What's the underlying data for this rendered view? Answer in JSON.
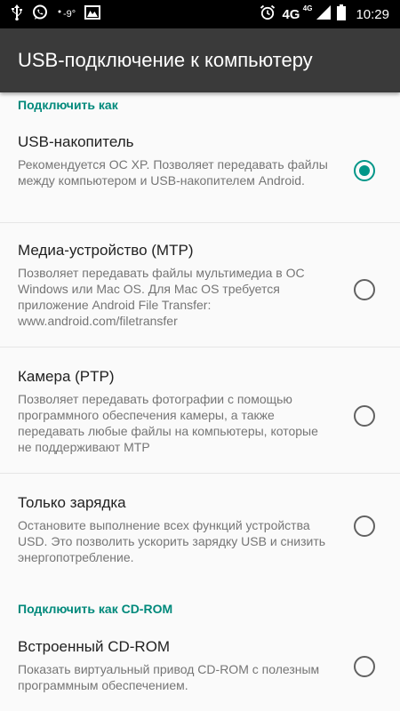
{
  "status_bar": {
    "icons_left": [
      "usb-icon",
      "whatsapp-icon",
      "weather-icon",
      "gallery-icon"
    ],
    "temperature": "-9°",
    "icons_right": [
      "alarm-icon",
      "signal-icon",
      "battery-icon"
    ],
    "network_type": "4G",
    "network_sub": "4G",
    "time": "10:29"
  },
  "app_bar": {
    "title": "USB-подключение к компьютеру"
  },
  "section_connect_as": {
    "header": "Подключить как",
    "options": [
      {
        "title": "USB-накопитель",
        "description": "Рекомендуется ОС XP. Позволяет передавать файлы между компьютером и USB-накопителем Android.",
        "selected": true
      },
      {
        "title": "Медиа-устройство (MTP)",
        "description": "Позволяет передавать файлы мультимедиа в ОС Windows или Mac OS. Для Mac OS требуется приложение Android File Transfer: www.android.com/filetransfer",
        "selected": false
      },
      {
        "title": "Камера (PTP)",
        "description": "Позволяет передавать фотографии с помощью программного обеспечения камеры, а также передавать любые файлы на компьютеры, которые не поддерживают MTP",
        "selected": false
      },
      {
        "title": "Только зарядка",
        "description": "Остановите выполнение всех функций устройства USD. Это позволить ускорить зарядку USB и снизить энергопотребление.",
        "selected": false
      }
    ]
  },
  "section_cdrom": {
    "header": "Подключить как CD-ROM",
    "options": [
      {
        "title": "Встроенный CD-ROM",
        "description": "Показать виртуальный привод CD-ROM с полезным программным обеспечением.",
        "selected": false
      }
    ]
  },
  "colors": {
    "accent": "#009688",
    "app_bar": "#3a3a3a",
    "status_bar": "#000000",
    "background": "#fafafa"
  }
}
